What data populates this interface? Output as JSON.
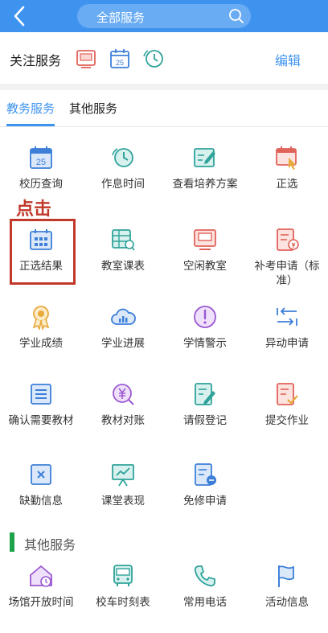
{
  "header": {
    "title": "全部服务"
  },
  "favorites": {
    "label": "关注服务",
    "edit_label": "编辑",
    "icons": [
      "monitor-icon",
      "calendar-icon",
      "clock-icon"
    ],
    "calendar_day": "25"
  },
  "tabs": [
    {
      "label": "教务服务",
      "active": true
    },
    {
      "label": "其他服务",
      "active": false
    }
  ],
  "annotation": {
    "text": "点击"
  },
  "academic_services": [
    {
      "label": "校历查询",
      "icon": "calendar-icon",
      "badge": "25"
    },
    {
      "label": "作息时间",
      "icon": "clock-icon"
    },
    {
      "label": "查看培养方案",
      "icon": "edit-icon"
    },
    {
      "label": "正选",
      "icon": "calendar-click-icon"
    },
    {
      "label": "正选结果",
      "icon": "calendar-grid-icon"
    },
    {
      "label": "教室课表",
      "icon": "classroom-table-icon"
    },
    {
      "label": "空闲教室",
      "icon": "monitor-icon"
    },
    {
      "label": "补考申请（标准）",
      "icon": "document-icon"
    },
    {
      "label": "学业成绩",
      "icon": "medal-icon"
    },
    {
      "label": "学业进展",
      "icon": "cloud-chart-icon"
    },
    {
      "label": "学情警示",
      "icon": "warning-icon"
    },
    {
      "label": "异动申请",
      "icon": "transfer-icon"
    },
    {
      "label": "确认需要教材",
      "icon": "list-icon"
    },
    {
      "label": "教材对账",
      "icon": "money-icon"
    },
    {
      "label": "请假登记",
      "icon": "pencil-doc-icon"
    },
    {
      "label": "提交作业",
      "icon": "check-doc-icon"
    },
    {
      "label": "缺勤信息",
      "icon": "x-box-icon"
    },
    {
      "label": "课堂表现",
      "icon": "presentation-icon"
    },
    {
      "label": "免修申请",
      "icon": "exempt-doc-icon"
    }
  ],
  "other_section_title": "其他服务",
  "other_services": [
    {
      "label": "场馆开放时间",
      "icon": "venue-clock-icon"
    },
    {
      "label": "校车时刻表",
      "icon": "bus-icon"
    },
    {
      "label": "常用电话",
      "icon": "phone-icon"
    },
    {
      "label": "活动信息",
      "icon": "flag-icon"
    }
  ],
  "colors": {
    "primary": "#3e93ee",
    "annotation": "#c0392b",
    "section_accent": "#1fa34a",
    "icon_blue": "#3d7fd8",
    "icon_teal": "#2fa39a",
    "icon_red": "#e0635a",
    "icon_gold": "#e8a93b",
    "icon_purple": "#9b59d0"
  }
}
